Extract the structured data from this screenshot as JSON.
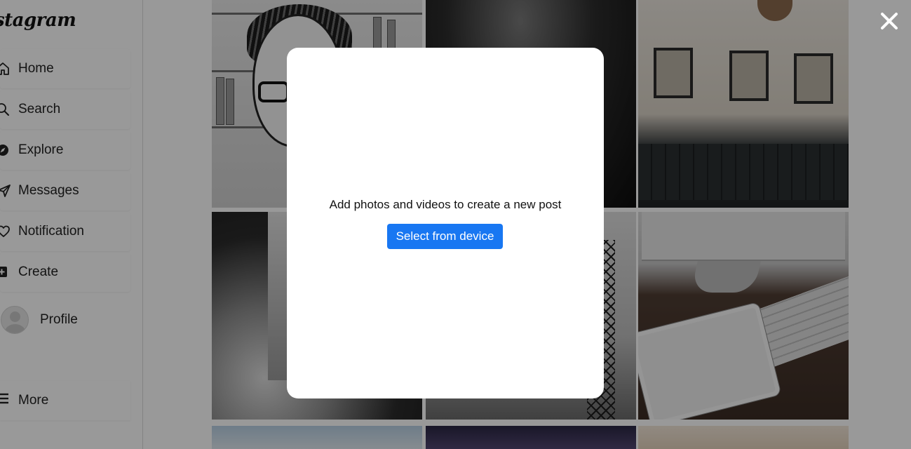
{
  "app": {
    "logo_text": "stagram"
  },
  "sidebar": {
    "items": [
      {
        "label": "Home",
        "icon": "home-icon"
      },
      {
        "label": "Search",
        "icon": "search-icon"
      },
      {
        "label": "Explore",
        "icon": "compass-icon"
      },
      {
        "label": "Messages",
        "icon": "send-icon"
      },
      {
        "label": "Notification",
        "icon": "heart-icon"
      },
      {
        "label": "Create",
        "icon": "plus-square-icon"
      }
    ],
    "profile_label": "Profile",
    "more_label": "More"
  },
  "modal": {
    "message": "Add photos and videos to create a new post",
    "select_button_label": "Select from device"
  },
  "colors": {
    "primary_button": "#1877f2",
    "overlay": "rgba(0,0,0,0.40)"
  }
}
